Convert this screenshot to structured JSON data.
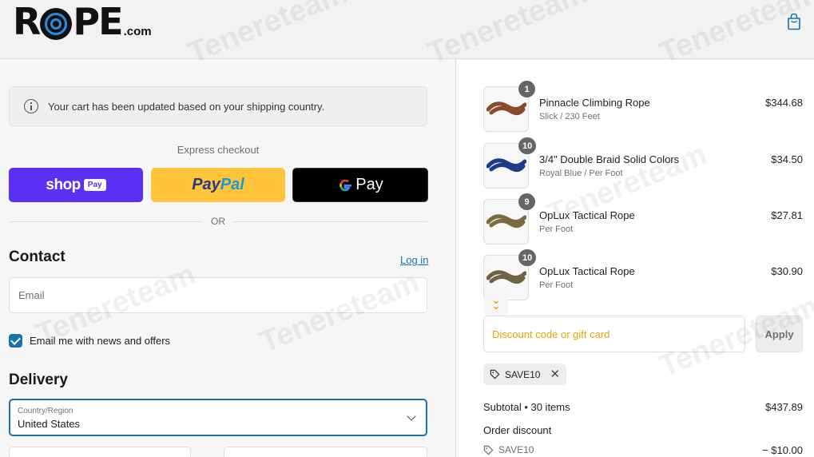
{
  "header": {
    "logo_main": "R",
    "logo_rest": "PE",
    "logo_com": ".com",
    "cart_icon": "shopping-bag-icon"
  },
  "notice": {
    "text": "Your cart has been updated based on your shipping country.",
    "icon": "info-icon"
  },
  "express": {
    "label": "Express checkout",
    "shop_pay": {
      "text": "shop",
      "badge": "Pay"
    },
    "paypal": {
      "part1": "Pay",
      "part2": "Pal"
    },
    "gpay": {
      "g": "G",
      "text": "Pay"
    },
    "or_label": "OR"
  },
  "contact": {
    "heading": "Contact",
    "login_link": "Log in",
    "email_placeholder": "Email",
    "newsletter_label": "Email me with news and offers",
    "newsletter_checked": true
  },
  "delivery": {
    "heading": "Delivery",
    "country_label": "Country/Region",
    "country_value": "United States"
  },
  "cart": {
    "items": [
      {
        "qty": "1",
        "name": "Pinnacle Climbing Rope",
        "variant": "Slick / 230 Feet",
        "price": "$344.68",
        "rope_color": "#8a4a2c"
      },
      {
        "qty": "10",
        "name": "3/4\" Double Braid Solid Colors",
        "variant": "Royal Blue / Per Foot",
        "price": "$34.50",
        "rope_color": "#1f3a8a"
      },
      {
        "qty": "9",
        "name": "OpLux Tactical Rope",
        "variant": "Per Foot",
        "price": "$27.81",
        "rope_color": "#7a6b3e"
      },
      {
        "qty": "10",
        "name": "OpLux Tactical Rope",
        "variant": "Per Foot",
        "price": "$30.90",
        "rope_color": "#6e6442"
      }
    ],
    "discount_placeholder": "Discount code or gift card",
    "apply_label": "Apply",
    "applied_code": "SAVE10",
    "subtotal_label": "Subtotal • 30 items",
    "subtotal_value": "$437.89",
    "order_discount_label": "Order discount",
    "discount_code": "SAVE10",
    "discount_value": "− $10.00"
  },
  "watermark": "Tenereteam",
  "colors": {
    "accent": "#1773b0",
    "shop_pay": "#5a31f4",
    "paypal": "#ffc439",
    "placeholder_highlight": "#e5a400"
  }
}
